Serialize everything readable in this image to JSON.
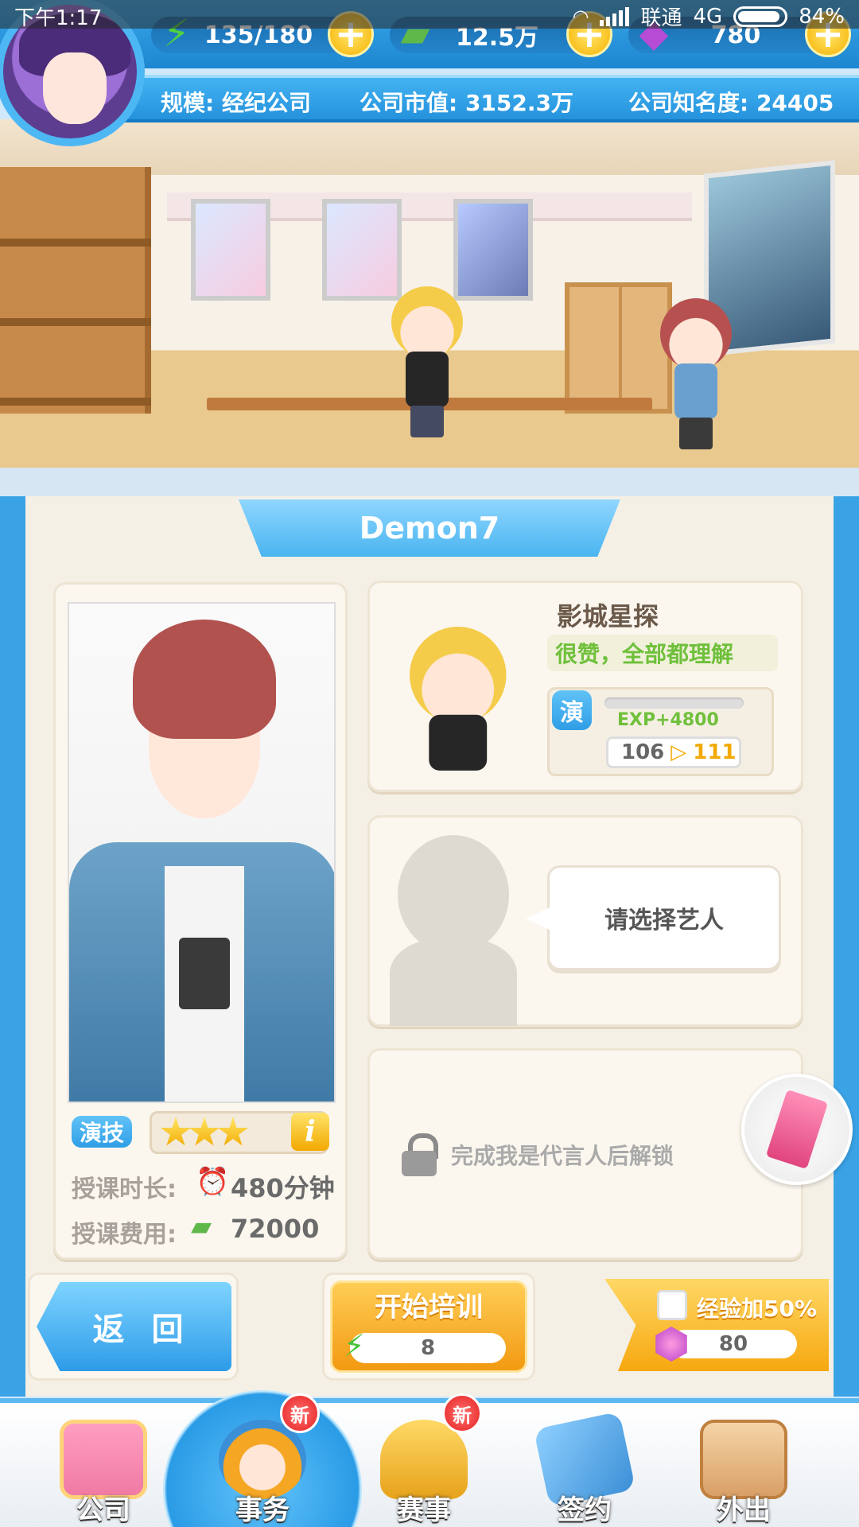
{
  "status_bar": {
    "time": "下午1:17",
    "carrier": "联通",
    "network": "4G",
    "battery": "84%"
  },
  "resources": {
    "energy": {
      "icon": "energy-hourglass-icon",
      "value": "135/180"
    },
    "money": {
      "icon": "cash-stack-icon",
      "value": "12.5万"
    },
    "gems": {
      "icon": "purple-gem-icon",
      "value": "780"
    }
  },
  "company_info": {
    "scale": "规模: 经纪公司",
    "market_value": "公司市值: 3152.3万",
    "fame": "公司知名度: 24405"
  },
  "panel": {
    "artist_name": "Demon7"
  },
  "artist": {
    "skill_tag": "演技",
    "stars": 3,
    "duration_label": "授课时长:",
    "duration_value": "480分钟",
    "fee_label": "授课费用:",
    "fee_value": "72000"
  },
  "coach": {
    "name": "影城星探",
    "comment": "很赞，全部都理解",
    "skill_badge": "演",
    "exp_gain": "EXP+4800",
    "level_from": "106",
    "level_to": "111",
    "exp_progress": 0.0
  },
  "select_slot": {
    "prompt": "请选择艺人"
  },
  "locked_slot": {
    "text": "完成我是代言人后解锁"
  },
  "actions": {
    "back_label": "返 回",
    "train_label": "开始培训",
    "train_cost": "8",
    "bonus_label": "经验加50%",
    "bonus_cost": "80"
  },
  "nav": [
    {
      "label": "公司",
      "icon": "company-building-icon",
      "active": false,
      "new": false
    },
    {
      "label": "事务",
      "icon": "affairs-manager-icon",
      "active": true,
      "new": true
    },
    {
      "label": "赛事",
      "icon": "trophy-icon",
      "active": false,
      "new": true
    },
    {
      "label": "签约",
      "icon": "contract-handshake-icon",
      "active": false,
      "new": false
    },
    {
      "label": "外出",
      "icon": "exit-door-icon",
      "active": false,
      "new": false
    }
  ],
  "new_badge_text": "新"
}
